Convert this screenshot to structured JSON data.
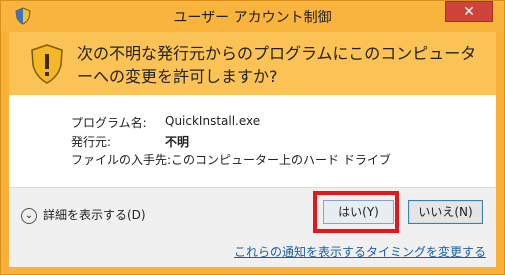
{
  "window": {
    "title": "ユーザー アカウント制御",
    "close_glyph": "✕"
  },
  "prompt": {
    "question": "次の不明な発行元からのプログラムにこのコンピューターへの変更を許可しますか?"
  },
  "info": {
    "program_label": "プログラム名:",
    "program_value": "QuickInstall.exe",
    "publisher_label": "発行元:",
    "publisher_value": "不明",
    "source_label": "ファイルの入手先:",
    "source_value": "このコンピューター上のハード ドライブ"
  },
  "actions": {
    "details_label": "詳細を表示する(D)",
    "yes_label": "はい(Y)",
    "no_label": "いいえ(N)",
    "change_link": "これらの通知を表示するタイミングを変更する"
  },
  "colors": {
    "title_band": "#f8b43c",
    "warning_band": "#fbc255",
    "highlight": "#e5151b",
    "link": "#1a5ea8"
  },
  "icons": {
    "title": "uac-shield-icon",
    "warning": "warning-shield-icon",
    "details": "chevron-down-circle-icon",
    "close": "close-icon"
  }
}
